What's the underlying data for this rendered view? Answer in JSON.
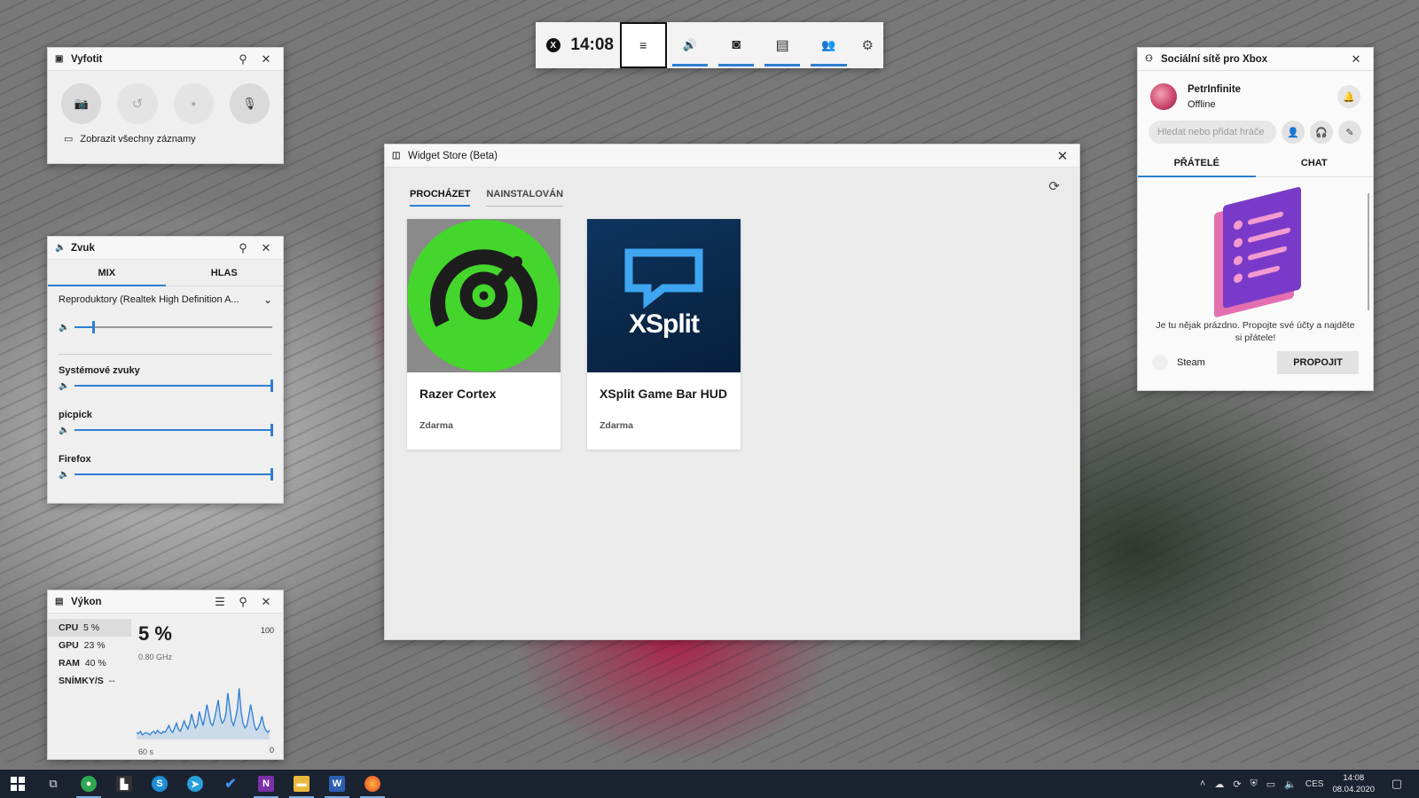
{
  "gamebar": {
    "time": "14:08",
    "xbox_glyph": "X",
    "menu_glyph": "≡",
    "audio_glyph": "🔊",
    "capture_glyph": "◙",
    "performance_glyph": "▤",
    "social_glyph": "👥",
    "settings_glyph": "⚙"
  },
  "capture": {
    "title": "Vyfotit",
    "screenshot_glyph": "📷",
    "record_last_glyph": "↺",
    "record_glyph": "●",
    "mic_glyph": "🎙",
    "show_all_label": "Zobrazit všechny záznamy"
  },
  "audio": {
    "title": "Zvuk",
    "tabs": [
      "MIX",
      "HLAS"
    ],
    "device": "Reproduktory (Realtek High Definition A...",
    "master_level": 0.1,
    "apps": [
      {
        "name": "Systémové zvuky",
        "level": 1.0
      },
      {
        "name": "picpick",
        "level": 1.0
      },
      {
        "name": "Firefox",
        "level": 1.0
      }
    ]
  },
  "performance": {
    "title": "Výkon",
    "items": [
      {
        "label": "CPU",
        "value": "5 %"
      },
      {
        "label": "GPU",
        "value": "23 %"
      },
      {
        "label": "RAM",
        "value": "40 %"
      },
      {
        "label": "SNÍMKY/S",
        "value": "--"
      }
    ],
    "current": "5 %",
    "frequency": "0.80 GHz",
    "max_label": "100",
    "min_label": "0",
    "span_label": "60 s",
    "series": [
      6,
      5,
      7,
      4,
      5,
      6,
      5,
      4,
      6,
      7,
      5,
      8,
      6,
      5,
      7,
      6,
      9,
      12,
      8,
      6,
      10,
      14,
      9,
      7,
      11,
      16,
      12,
      9,
      14,
      22,
      15,
      10,
      13,
      24,
      18,
      12,
      20,
      30,
      22,
      14,
      12,
      18,
      26,
      34,
      20,
      14,
      16,
      22,
      40,
      28,
      16,
      12,
      18,
      26,
      44,
      24,
      14,
      10,
      12,
      20,
      30,
      22,
      12,
      8,
      10,
      14,
      20,
      12,
      8,
      6,
      8
    ]
  },
  "store": {
    "title": "Widget Store (Beta)",
    "tabs": [
      "PROCHÁZET",
      "NAINSTALOVÁN"
    ],
    "refresh_glyph": "⟳",
    "cards": [
      {
        "name": "Razer Cortex",
        "price": "Zdarma"
      },
      {
        "name": "XSplit Game Bar HUD",
        "price": "Zdarma",
        "logo_text": "XSplit"
      }
    ]
  },
  "social": {
    "title": "Sociální sítě pro Xbox",
    "username": "PetrInfinite",
    "status": "Offline",
    "search_placeholder": "Hledat nebo přidat hráče",
    "tabs": [
      "PŘÁTELÉ",
      "CHAT"
    ],
    "empty_message": "Je tu nějak prázdno. Propojte své účty a najděte si přátele!",
    "steam_label": "Steam",
    "connect_label": "PROPOJIT"
  },
  "taskbar": {
    "language": "CES",
    "time": "14:08",
    "date": "08.04.2020"
  },
  "colors": {
    "accent": "#2d7fd2",
    "razer_green": "#44d62c"
  }
}
